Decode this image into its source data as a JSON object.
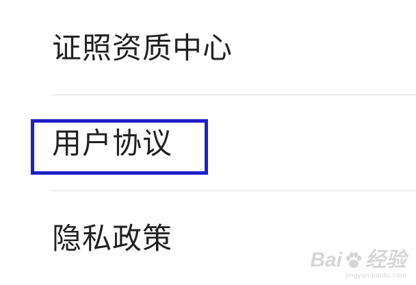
{
  "menu": {
    "items": [
      {
        "label": "证照资质中心"
      },
      {
        "label": "用户协议"
      },
      {
        "label": "隐私政策"
      }
    ]
  },
  "highlight": {
    "color": "#1f1fc8"
  },
  "watermark": {
    "brand_prefix": "Bai",
    "brand_suffix": "经验",
    "url": "jingyan.baidu.com",
    "icon": "paw-icon"
  }
}
